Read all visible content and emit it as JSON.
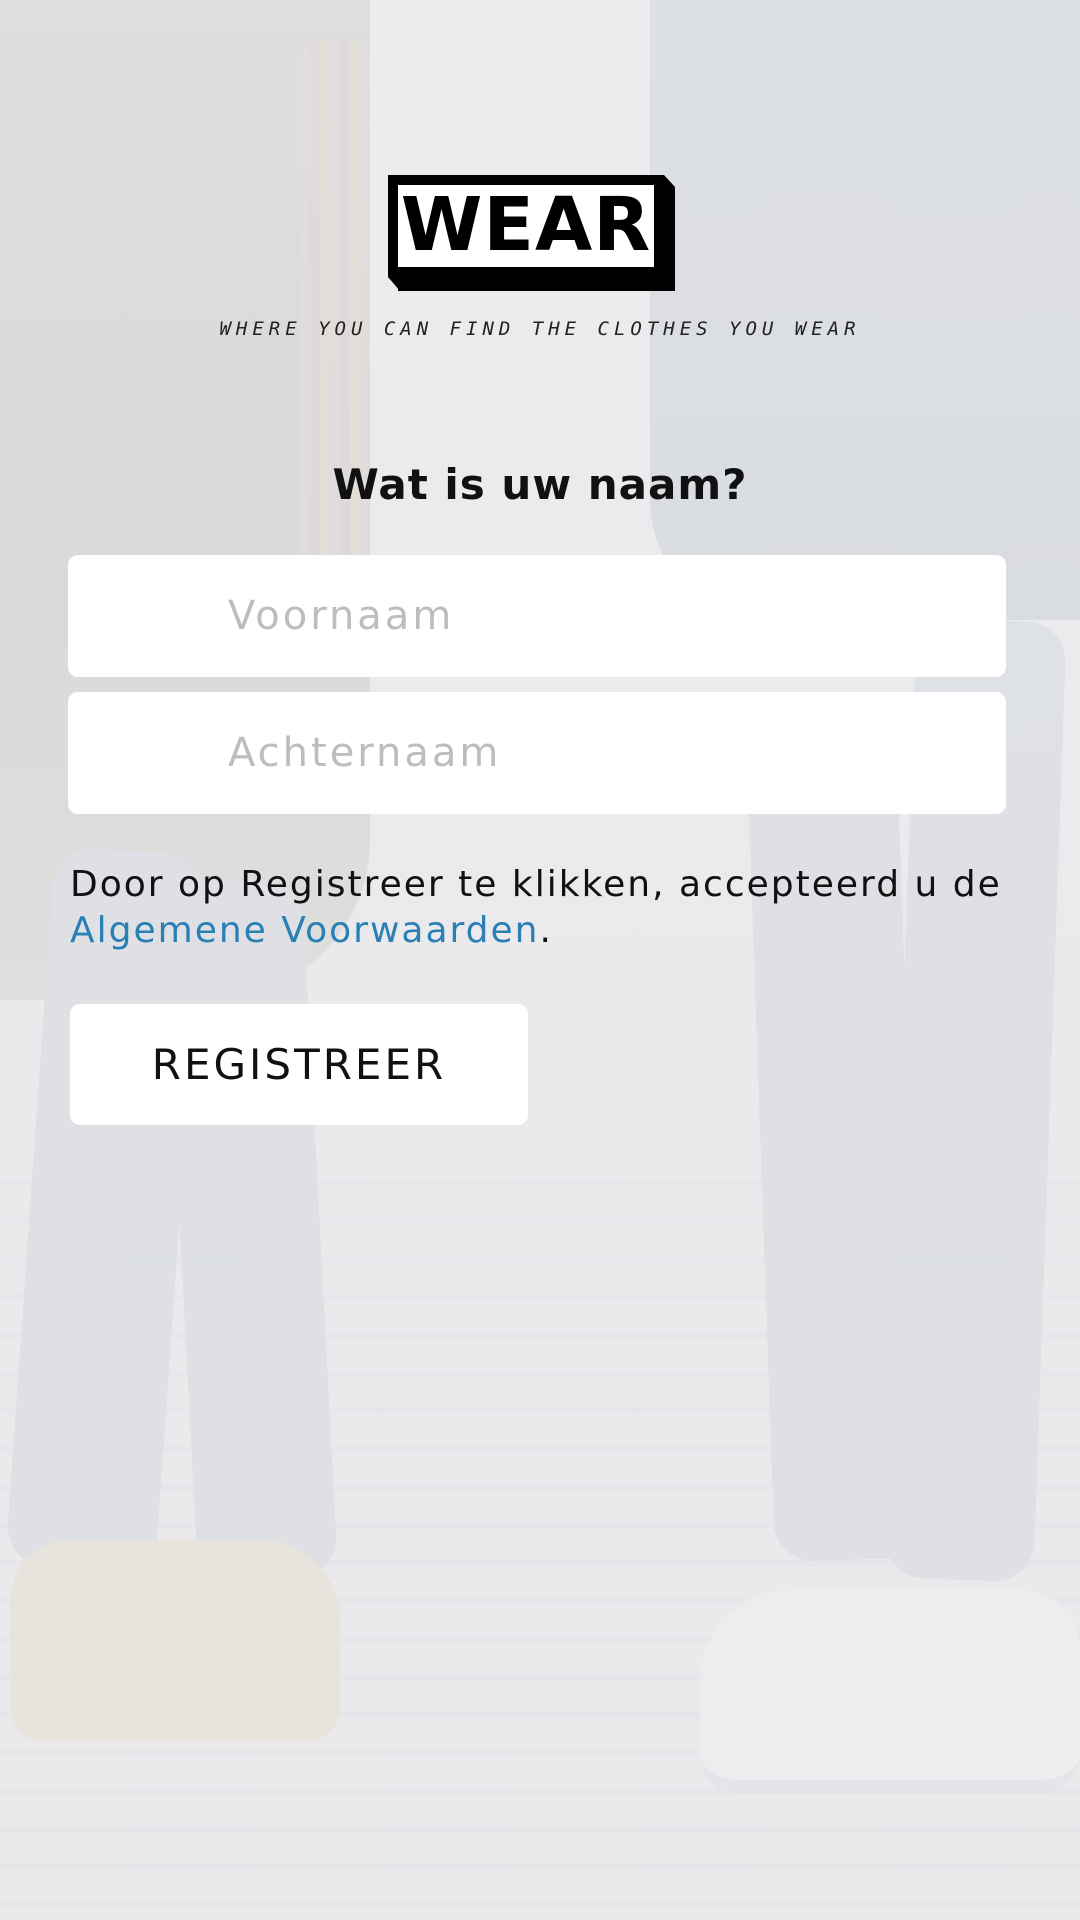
{
  "brand": {
    "logo_text": "WEAR",
    "tagline": "WHERE YOU CAN FIND THE CLOTHES YOU WEAR"
  },
  "form": {
    "heading": "Wat is uw naam?",
    "first_name": {
      "value": "",
      "placeholder": "Voornaam"
    },
    "last_name": {
      "value": "",
      "placeholder": "Achternaam"
    }
  },
  "terms": {
    "prefix": "Door op Registreer te klikken, accepteerd u de ",
    "link_text": "Algemene Voorwaarden",
    "suffix": "."
  },
  "actions": {
    "register_label": "REGISTREER"
  },
  "colors": {
    "link": "#2a7fb5",
    "field_background": "#ffffff",
    "placeholder": "#bdbdbd"
  }
}
